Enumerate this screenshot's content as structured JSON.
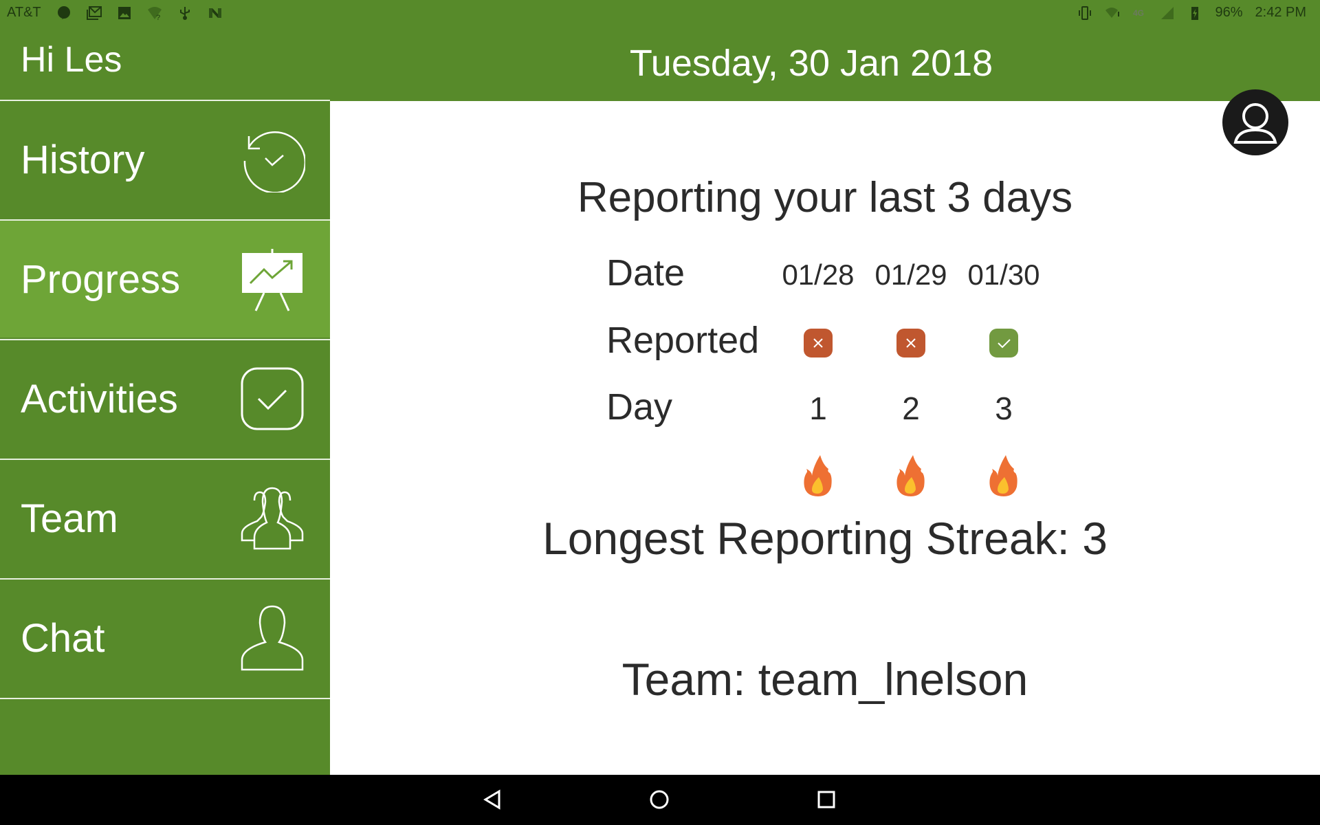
{
  "status_bar": {
    "carrier": "AT&T",
    "battery": "96%",
    "time": "2:42 PM"
  },
  "header": {
    "greeting": "Hi Les",
    "date": "Tuesday, 30 Jan 2018"
  },
  "sidebar": {
    "items": [
      {
        "label": "History",
        "icon": "history-icon"
      },
      {
        "label": "Progress",
        "icon": "presentation-chart-icon",
        "active": true
      },
      {
        "label": "Activities",
        "icon": "checkbox-icon"
      },
      {
        "label": "Team",
        "icon": "group-icon"
      },
      {
        "label": "Chat",
        "icon": "person-icon"
      }
    ]
  },
  "main": {
    "title": "Reporting your last 3 days",
    "labels": {
      "date": "Date",
      "reported": "Reported",
      "day": "Day"
    },
    "days": [
      {
        "date": "01/28",
        "reported": false,
        "day": "1"
      },
      {
        "date": "01/29",
        "reported": false,
        "day": "2"
      },
      {
        "date": "01/30",
        "reported": true,
        "day": "3"
      }
    ],
    "streak": "Longest Reporting Streak: 3",
    "team": "Team: team_lnelson"
  },
  "colors": {
    "brand": "#578a2a",
    "active": "#6ea537",
    "missed": "#c0572f",
    "reported": "#729a40"
  }
}
